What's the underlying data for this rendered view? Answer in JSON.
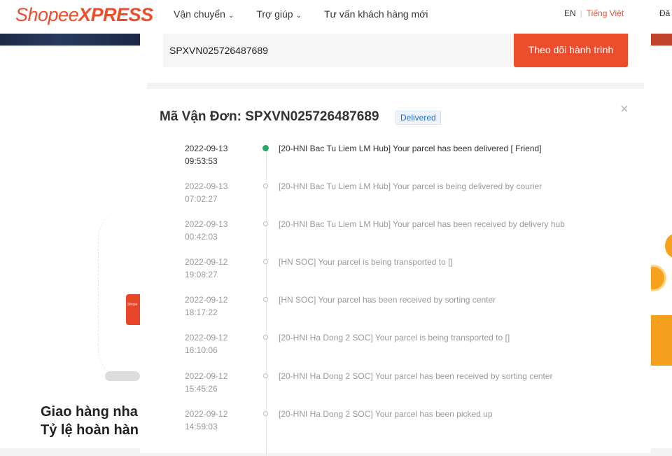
{
  "header": {
    "logo_shopee": "Shopee",
    "logo_xpress": "XPRESS",
    "nav": [
      {
        "label": "Vận chuyển",
        "has_dropdown": true
      },
      {
        "label": "Trợ giúp",
        "has_dropdown": true
      },
      {
        "label": "Tư vấn khách hàng mới",
        "has_dropdown": false
      }
    ],
    "lang_en": "EN",
    "lang_sep": "|",
    "lang_vi": "Tiếng Việt",
    "login": "Đă"
  },
  "search": {
    "value": "SPXVN025726487689",
    "button": "Theo dõi hành trình"
  },
  "result": {
    "title": "Mã Vận Đơn: SPXVN025726487689",
    "status": "Delivered",
    "close": "×",
    "events": [
      {
        "date": "2022-09-13",
        "time": "09:53:53",
        "text": "[20-HNI Bac Tu Liem LM Hub] Your parcel has been delivered [ Friend]"
      },
      {
        "date": "2022-09-13",
        "time": "07:02:27",
        "text": "[20-HNI Bac Tu Liem LM Hub] Your parcel is being delivered by courier"
      },
      {
        "date": "2022-09-13",
        "time": "00:42:03",
        "text": "[20-HNI Bac Tu Liem LM Hub] Your parcel has been received by delivery hub"
      },
      {
        "date": "2022-09-12",
        "time": "19:08:27",
        "text": "[HN SOC] Your parcel is being transported to []"
      },
      {
        "date": "2022-09-12",
        "time": "18:17:22",
        "text": "[HN SOC] Your parcel has been received by sorting center"
      },
      {
        "date": "2022-09-12",
        "time": "16:10:06",
        "text": "[20-HNI Ha Dong 2 SOC] Your parcel is being transported to []"
      },
      {
        "date": "2022-09-12",
        "time": "15:45:26",
        "text": "[20-HNI Ha Dong 2 SOC] Your parcel has been received by sorting center"
      },
      {
        "date": "2022-09-12",
        "time": "14:59:03",
        "text": "[20-HNI Ha Dong 2 SOC] Your parcel has been picked up"
      }
    ]
  },
  "promo": {
    "line1": "Giao hàng nha",
    "line2": "Tỷ lệ hoàn hàn"
  },
  "decor": {
    "coin_text": "₫",
    "phone_text": "Shope"
  },
  "colors": {
    "brand": "#ee4d2d",
    "delivered_dot": "#26aa64",
    "badge_text": "#1e6fd9"
  }
}
